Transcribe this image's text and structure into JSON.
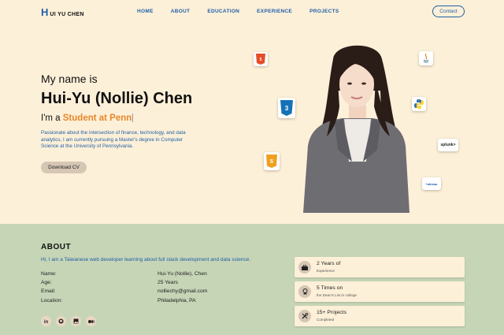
{
  "nav": {
    "logo_mark": "H",
    "logo_text": "UI YU CHEN",
    "links": [
      "HOME",
      "ABOUT",
      "EDUCATION",
      "EXPERIENCE",
      "PROJECTS"
    ],
    "contact_label": "Contact"
  },
  "hero": {
    "intro": "My name is",
    "name": "Hui-Yu (Nollie) Chen",
    "role_prefix": "I'm a",
    "role_highlight": "Student at Penn",
    "description": "Passionate about the intersection of finance, technology, and data analytics, I am currently pursuing a Master's degree in Computer Science at the University of Pennsylvania.",
    "cv_label": "Download CV",
    "tech_icons": {
      "html": "HTML",
      "css": "CSS",
      "js": "JS",
      "java": "Java",
      "splunk": "splunk>",
      "tableau": "+ableau"
    }
  },
  "about": {
    "title": "ABOUT",
    "intro": "Hi, I am a Taiwanese web developer learning about full stack development and data science.",
    "info": [
      {
        "label": "Name:",
        "value": "Hui-Yu (Nollie), Chen"
      },
      {
        "label": "Age:",
        "value": "25 Years"
      },
      {
        "label": "Email:",
        "value": "nolliechy@gmail.com"
      },
      {
        "label": "Location:",
        "value": "Philadelphia, PA"
      }
    ],
    "socials": [
      "linkedin-icon",
      "github-icon",
      "image-icon",
      "medium-icon"
    ],
    "stats": [
      {
        "title": "2 Years of",
        "sub": "Experience",
        "icon": "briefcase-icon"
      },
      {
        "title": "5 Times on",
        "sub": "the Dean's List in college",
        "icon": "award-icon"
      },
      {
        "title": "15+ Projects",
        "sub": "Completed",
        "icon": "tools-icon"
      }
    ]
  },
  "colors": {
    "background": "#fdf0d8",
    "about_background": "#c6d5b6",
    "accent_blue": "#1f5fa8",
    "accent_orange": "#e8872b",
    "button_bg": "#d6c6b4"
  }
}
